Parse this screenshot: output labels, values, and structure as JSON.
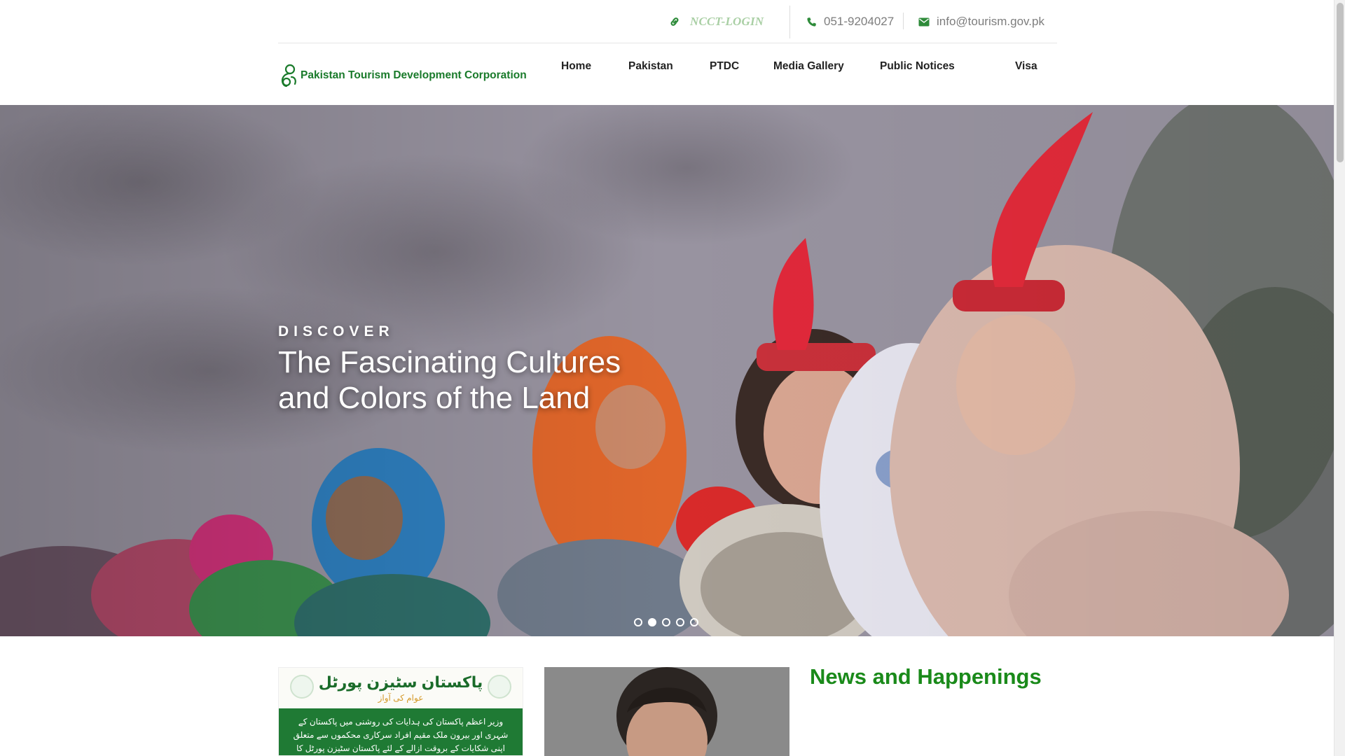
{
  "topbar": {
    "login_label": "NCCT-LOGIN",
    "phone": "051-9204027",
    "email": "info@tourism.gov.pk",
    "icons": {
      "login": "link-icon",
      "phone": "phone-icon",
      "email": "envelope-icon"
    },
    "accent": "#2e8b3a"
  },
  "brand": {
    "name": "Pakistan Tourism Development Corporation",
    "logo": "ptdc-logo-icon",
    "color": "#197a2a"
  },
  "nav": {
    "items": [
      {
        "label": "Home"
      },
      {
        "label": "Pakistan"
      },
      {
        "label": "PTDC"
      },
      {
        "label": "Media Gallery"
      },
      {
        "label": "Public Notices"
      },
      {
        "label": "Visa"
      }
    ]
  },
  "hero": {
    "kicker": "DISCOVER",
    "title": "The Fascinating Cultures and Colors of the Land",
    "slides_total": 5,
    "active_slide": 2
  },
  "portal": {
    "title": "پاکستان سٹیزن پورٹل",
    "subtitle": "عوام کی آواز",
    "body": "وزیر اعظم پاکستان کی ہدایات کی روشنی میں پاکستان کے شہری اور بیرون ملک مقیم افراد سرکاری محکموں سے متعلق اپنی شکایات کے بروقت ازالے کے لئے پاکستان سٹیزن پورٹل کا استعمال کریں"
  },
  "news": {
    "heading": "News and Happenings",
    "color": "#1a8a1a"
  }
}
